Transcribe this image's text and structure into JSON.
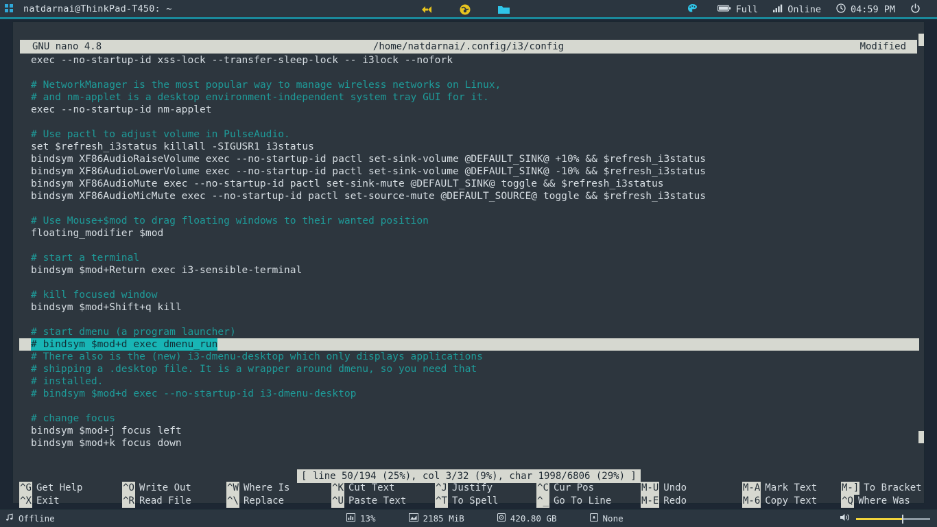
{
  "topbar": {
    "title": "natdarnai@ThinkPad-T450: ~",
    "grip_icon": "app-grid-icon",
    "center_icons": [
      {
        "name": "code-editor-icon"
      },
      {
        "name": "browser-globe-icon"
      },
      {
        "name": "file-manager-icon"
      }
    ],
    "right_items": [
      {
        "name": "palette",
        "icon": "palette-icon",
        "label": ""
      },
      {
        "name": "battery",
        "icon": "battery-icon",
        "label": "Full"
      },
      {
        "name": "network",
        "icon": "signal-bars-icon",
        "label": "Online"
      },
      {
        "name": "clock",
        "icon": "clock-icon",
        "label": "04:59 PM"
      },
      {
        "name": "power",
        "icon": "power-icon",
        "label": ""
      }
    ]
  },
  "nano": {
    "header": {
      "version": "GNU nano 4.8",
      "filepath": "/home/natdarnai/.config/i3/config",
      "state": "Modified"
    },
    "lines": [
      {
        "t": "tx",
        "s": "exec --no-startup-id xss-lock --transfer-sleep-lock -- i3lock --nofork"
      },
      {
        "t": "tx",
        "s": ""
      },
      {
        "t": "cm",
        "s": "# NetworkManager is the most popular way to manage wireless networks on Linux,"
      },
      {
        "t": "cm",
        "s": "# and nm-applet is a desktop environment-independent system tray GUI for it."
      },
      {
        "t": "tx",
        "s": "exec --no-startup-id nm-applet"
      },
      {
        "t": "tx",
        "s": ""
      },
      {
        "t": "cm",
        "s": "# Use pactl to adjust volume in PulseAudio."
      },
      {
        "t": "tx",
        "s": "set $refresh_i3status killall -SIGUSR1 i3status"
      },
      {
        "t": "tx",
        "s": "bindsym XF86AudioRaiseVolume exec --no-startup-id pactl set-sink-volume @DEFAULT_SINK@ +10% && $refresh_i3status"
      },
      {
        "t": "tx",
        "s": "bindsym XF86AudioLowerVolume exec --no-startup-id pactl set-sink-volume @DEFAULT_SINK@ -10% && $refresh_i3status"
      },
      {
        "t": "tx",
        "s": "bindsym XF86AudioMute exec --no-startup-id pactl set-sink-mute @DEFAULT_SINK@ toggle && $refresh_i3status"
      },
      {
        "t": "tx",
        "s": "bindsym XF86AudioMicMute exec --no-startup-id pactl set-source-mute @DEFAULT_SOURCE@ toggle && $refresh_i3status"
      },
      {
        "t": "tx",
        "s": ""
      },
      {
        "t": "cm",
        "s": "# Use Mouse+$mod to drag floating windows to their wanted position"
      },
      {
        "t": "tx",
        "s": "floating_modifier $mod"
      },
      {
        "t": "tx",
        "s": ""
      },
      {
        "t": "cm",
        "s": "# start a terminal"
      },
      {
        "t": "tx",
        "s": "bindsym $mod+Return exec i3-sensible-terminal"
      },
      {
        "t": "tx",
        "s": ""
      },
      {
        "t": "cm",
        "s": "# kill focused window"
      },
      {
        "t": "tx",
        "s": "bindsym $mod+Shift+q kill"
      },
      {
        "t": "tx",
        "s": ""
      },
      {
        "t": "cm",
        "s": "# start dmenu (a program launcher)"
      },
      {
        "t": "sel",
        "s": "# bindsym $mod+d exec dmenu_run"
      },
      {
        "t": "cm",
        "s": "# There also is the (new) i3-dmenu-desktop which only displays applications"
      },
      {
        "t": "cm",
        "s": "# shipping a .desktop file. It is a wrapper around dmenu, so you need that"
      },
      {
        "t": "cm",
        "s": "# installed."
      },
      {
        "t": "cm",
        "s": "# bindsym $mod+d exec --no-startup-id i3-dmenu-desktop"
      },
      {
        "t": "tx",
        "s": ""
      },
      {
        "t": "cm",
        "s": "# change focus"
      },
      {
        "t": "tx",
        "s": "bindsym $mod+j focus left"
      },
      {
        "t": "tx",
        "s": "bindsym $mod+k focus down"
      }
    ],
    "status": "[ line 50/194 (25%), col 3/32 (9%), char 1998/6806 (29%) ]",
    "shortcuts": [
      [
        {
          "key": "^G",
          "label": "Get Help"
        },
        {
          "key": "^X",
          "label": "Exit"
        }
      ],
      [
        {
          "key": "^O",
          "label": "Write Out"
        },
        {
          "key": "^R",
          "label": "Read File"
        }
      ],
      [
        {
          "key": "^W",
          "label": "Where Is"
        },
        {
          "key": "^\\",
          "label": "Replace"
        }
      ],
      [
        {
          "key": "^K",
          "label": "Cut Text"
        },
        {
          "key": "^U",
          "label": "Paste Text"
        }
      ],
      [
        {
          "key": "^J",
          "label": "Justify"
        },
        {
          "key": "^T",
          "label": "To Spell"
        }
      ],
      [
        {
          "key": "^C",
          "label": "Cur Pos"
        },
        {
          "key": "^_",
          "label": "Go To Line"
        }
      ],
      [
        {
          "key": "M-U",
          "label": "Undo"
        },
        {
          "key": "M-E",
          "label": "Redo"
        }
      ],
      [
        {
          "key": "M-A",
          "label": "Mark Text"
        },
        {
          "key": "M-6",
          "label": "Copy Text"
        }
      ],
      [
        {
          "key": "M-]",
          "label": "To Bracket"
        },
        {
          "key": "^Q",
          "label": "Where Was"
        }
      ]
    ]
  },
  "bottombar": {
    "left": {
      "icon": "music-note-icon",
      "label": "Offline"
    },
    "center": [
      {
        "name": "cpu",
        "icon": "bar-chart-icon",
        "label": "13%"
      },
      {
        "name": "memory",
        "icon": "memory-graph-icon",
        "label": "2185 MiB"
      },
      {
        "name": "disk",
        "icon": "disk-icon",
        "label": "420.80 GB"
      },
      {
        "name": "notifications",
        "icon": "bell-box-icon",
        "label": "None"
      }
    ],
    "right": {
      "icon": "speaker-icon",
      "volume_percent": 63
    }
  },
  "colors": {
    "accent": "#1a8a9c",
    "comment": "#1e9b99",
    "selection": "#18b5b5",
    "bar_bg": "#2b3640",
    "editor_bg": "#2d363e",
    "nano_bar": "#d6d8d0",
    "volume_fill": "#f2d43c"
  }
}
